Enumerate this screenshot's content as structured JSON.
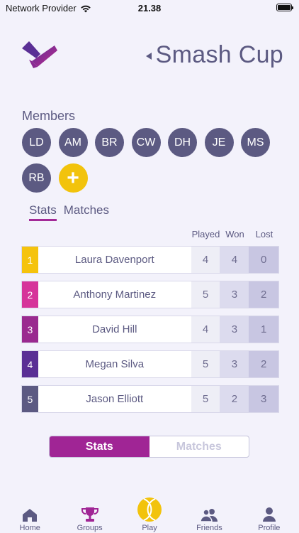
{
  "status_bar": {
    "carrier": "Network Provider",
    "time": "21.38",
    "battery_level": 1.0
  },
  "header": {
    "title": "Smash Cup"
  },
  "members": {
    "label": "Members",
    "list": [
      "LD",
      "AM",
      "BR",
      "CW",
      "DH",
      "JE",
      "MS",
      "RB"
    ],
    "add_label": "+"
  },
  "tabs": [
    {
      "label": "Stats",
      "active": true
    },
    {
      "label": "Matches",
      "active": false
    }
  ],
  "table": {
    "headers": {
      "played": "Played",
      "won": "Won",
      "lost": "Lost"
    },
    "rows": [
      {
        "rank": "1",
        "name": "Laura Davenport",
        "played": "4",
        "won": "4",
        "lost": "0",
        "color": "#f5c30d"
      },
      {
        "rank": "2",
        "name": "Anthony Martinez",
        "played": "5",
        "won": "3",
        "lost": "2",
        "color": "#d6349a"
      },
      {
        "rank": "3",
        "name": "David Hill",
        "played": "4",
        "won": "3",
        "lost": "1",
        "color": "#9a2a8f"
      },
      {
        "rank": "4",
        "name": "Megan Silva",
        "played": "5",
        "won": "3",
        "lost": "2",
        "color": "#5a2f95"
      },
      {
        "rank": "5",
        "name": "Jason Elliott",
        "played": "5",
        "won": "2",
        "lost": "3",
        "color": "#5c5a82"
      }
    ]
  },
  "segmented": {
    "stats_label": "Stats",
    "matches_label": "Matches"
  },
  "nav": [
    {
      "label": "Home",
      "icon": "home-icon"
    },
    {
      "label": "Groups",
      "icon": "trophy-icon"
    },
    {
      "label": "Play",
      "icon": "tennis-ball-icon"
    },
    {
      "label": "Friends",
      "icon": "friends-icon"
    },
    {
      "label": "Profile",
      "icon": "profile-icon"
    }
  ],
  "colors": {
    "accent": "#a02595",
    "primary": "#5c5a82",
    "yellow": "#f2c30c",
    "background": "#f3f2fb"
  }
}
